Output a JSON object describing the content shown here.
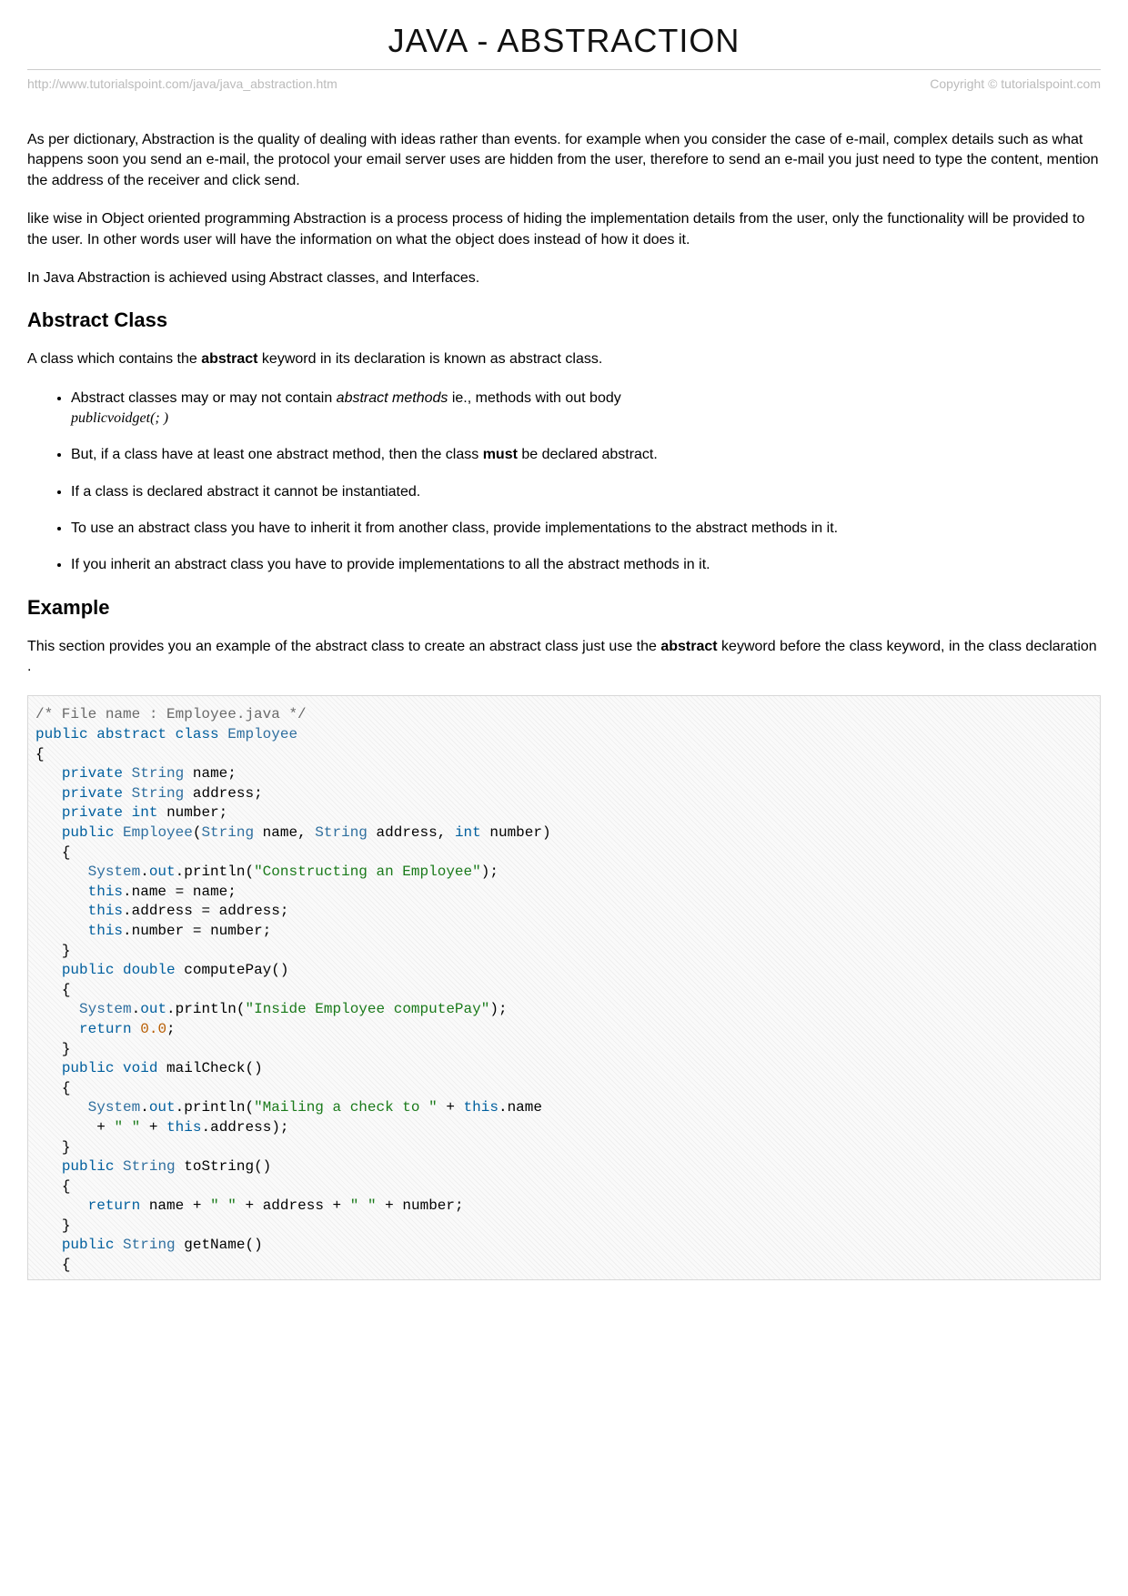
{
  "title": "JAVA - ABSTRACTION",
  "meta": {
    "url": "http://www.tutorialspoint.com/java/java_abstraction.htm",
    "copyright": "Copyright © tutorialspoint.com"
  },
  "p1": "As per dictionary, Abstraction is the quality of dealing with ideas rather than events. for example when you consider the case of e-mail, complex details such as what happens soon you send an e-mail, the protocol your email server uses are hidden from the user, therefore to send an e-mail you just need to type the content, mention the address of the receiver and click send.",
  "p2": "like wise in Object oriented programming Abstraction is a process process of hiding the implementation details from the user, only the functionality will be provided to the user. In other words user will have the information on what the object does instead of how it does it.",
  "p3": "In Java Abstraction is achieved using Abstract classes, and Interfaces.",
  "h_abstract": "Abstract Class",
  "p_abstract_intro_1": "A class which contains the ",
  "p_abstract_intro_b": "abstract",
  "p_abstract_intro_2": " keyword in its declaration is known as abstract class.",
  "bullets": {
    "b1a": "Abstract classes may or may not contain ",
    "b1i": "abstract methods",
    "b1b": " ie., methods with out body ",
    "b1code": "publicvoidget(; )",
    "b2a": "But, if a class have at least one abstract method, then the class ",
    "b2b": "must",
    "b2c": " be declared abstract.",
    "b3": "If a class is declared abstract it cannot be instantiated.",
    "b4": "To use an abstract class you have to inherit it from another class, provide implementations to the abstract methods in it.",
    "b5": "If you inherit an abstract class you have to provide implementations to all the abstract methods in it."
  },
  "h_example": "Example",
  "p_example_1": "This section provides you an example of the abstract class to create an abstract class just use the ",
  "p_example_b": "abstract",
  "p_example_2": " keyword before the class keyword, in the class declaration .",
  "code": {
    "c0": "/* File name : Employee.java */",
    "kw_public": "public",
    "kw_abstract": "abstract",
    "kw_class": "class",
    "kw_private": "private",
    "kw_int": "int",
    "kw_double": "double",
    "kw_void": "void",
    "kw_return": "return",
    "kw_this": "this",
    "kw_out": "out",
    "id_Employee": "Employee",
    "id_String": "String",
    "id_System": "System",
    "fn_println": "println",
    "v_name": "name",
    "v_address": "address",
    "v_number": "number",
    "m_computePay": "computePay",
    "m_mailCheck": "mailCheck",
    "m_toString": "toString",
    "m_getName": "getName",
    "s_constructing": "\"Constructing an Employee\"",
    "s_inside": "\"Inside Employee computePay\"",
    "s_mailing": "\"Mailing a check to \"",
    "s_space": "\" \"",
    "n_zero": "0.0",
    "brace_l": "{",
    "brace_r": "}",
    "paren_l": "(",
    "paren_r": ")",
    "semi": ";",
    "comma": ",",
    "eq": "=",
    "plus": "+",
    "dot": "."
  }
}
